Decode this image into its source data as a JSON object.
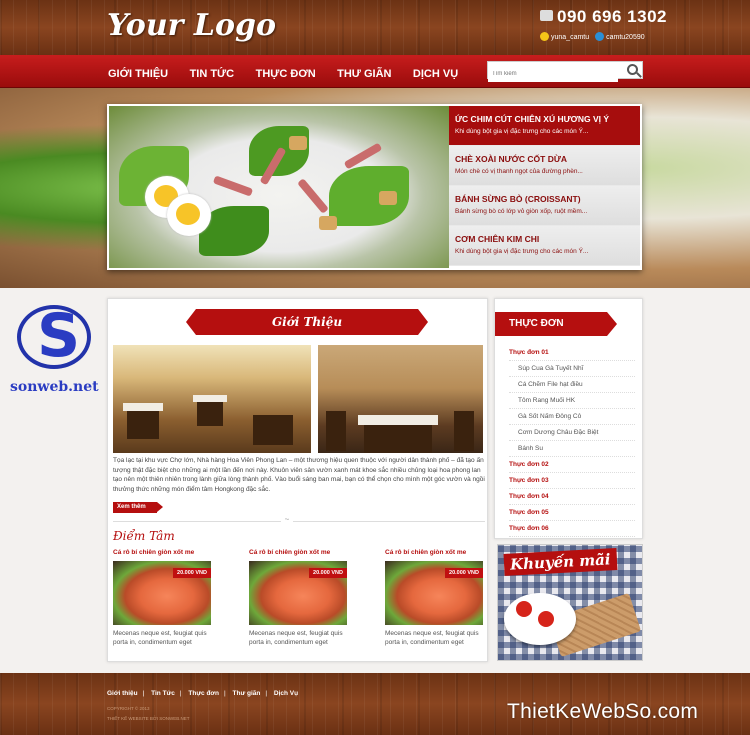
{
  "header": {
    "logo": "Your Logo",
    "phone": "090 696 1302",
    "yahoo": "yuna_camtu",
    "skype": "camtu20590"
  },
  "nav": {
    "items": [
      "GIỚI THIỆU",
      "TIN TỨC",
      "THỰC ĐƠN",
      "THƯ GIÃN",
      "DỊCH VỤ"
    ],
    "search_placeholder": "Tìm kiếm"
  },
  "slider": {
    "items": [
      {
        "title": "ỨC CHIM CÚT CHIÊN XÚ HƯƠNG VỊ Ý",
        "desc": "Khi dùng bột gia vị đặc trưng cho các món Ý..."
      },
      {
        "title": "CHÈ XOÀI NƯỚC CỐT DỪA",
        "desc": "Món chè có vị thanh ngọt của đường phèn..."
      },
      {
        "title": "BÁNH SỪNG BÒ (CROISSANT)",
        "desc": "Bánh sừng bò có lớp vỏ giòn xốp, ruột mềm..."
      },
      {
        "title": "CƠM CHIÊN KIM CHI",
        "desc": "Khi dùng bột gia vị đặc trưng cho các món Ý..."
      }
    ]
  },
  "sonweb": {
    "name": "sonweb.net"
  },
  "intro": {
    "title": "Giới Thiệu",
    "text": "Tọa lạc tại khu vực Chợ lớn, Nhà hàng Hoa Viên Phong Lan – một thương hiệu quen thuộc với người dân thành phố – đã tạo ấn tượng thật đặc biệt cho những ai một lần đến nơi này. Khuôn viên sân vườn xanh mát khoe sắc nhiều chủng loại hoa phong lan tạo nên một thiên nhiên trong lành giữa lòng thành phố. Vào buổi sáng ban mai, bạn có thể chọn cho mình một góc vườn và ngồi thưởng thức những món điểm tâm Hongkong đặc sắc.",
    "more": "Xem thêm"
  },
  "dimsum": {
    "title": "Điểm Tâm",
    "items": [
      {
        "name": "Cá rô bí chiên giòn xốt me",
        "price": "20.000 VND",
        "desc": "Mecenas neque est, feugiat quis porta in, condimentum eget"
      },
      {
        "name": "Cá rô bí chiên giòn xốt me",
        "price": "20.000 VND",
        "desc": "Mecenas neque est, feugiat quis porta in, condimentum eget"
      },
      {
        "name": "Cá rô bí chiên giòn xốt me",
        "price": "20.000 VND",
        "desc": "Mecenas neque est, feugiat quis porta in, condimentum eget"
      }
    ]
  },
  "sidebar": {
    "title": "THỰC ĐƠN",
    "items": [
      {
        "label": "Thực đơn 01",
        "type": "cat"
      },
      {
        "label": "Súp Cua Gà Tuyết Nhĩ",
        "type": "sub"
      },
      {
        "label": "Cá Chẽm File hạt điều",
        "type": "sub"
      },
      {
        "label": "Tôm Rang Muối HK",
        "type": "sub"
      },
      {
        "label": "Gà Sốt Nấm Đông Cô",
        "type": "sub"
      },
      {
        "label": "Cơm Dương Châu Đặc Biệt",
        "type": "sub"
      },
      {
        "label": "Bánh Su",
        "type": "sub"
      },
      {
        "label": "Thực đơn 02",
        "type": "cat"
      },
      {
        "label": "Thực đơn 03",
        "type": "cat"
      },
      {
        "label": "Thực đơn 04",
        "type": "cat"
      },
      {
        "label": "Thực đơn 05",
        "type": "cat"
      },
      {
        "label": "Thực đơn 06",
        "type": "cat"
      }
    ],
    "promo": "Khuyến mãi"
  },
  "footer": {
    "links": [
      "Giới thiệu",
      "Tin Tức",
      "Thực đơn",
      "Thư giãn",
      "Dịch Vụ"
    ],
    "copyright": "COPYRIGHT © 2013",
    "credit": "THIẾT KẾ WEBSITE BỞI SONWEB.NET",
    "watermark": "ThietKeWebSo.com"
  },
  "colors": {
    "brand_red": "#b50f0f",
    "wood": "#7a3a18"
  }
}
